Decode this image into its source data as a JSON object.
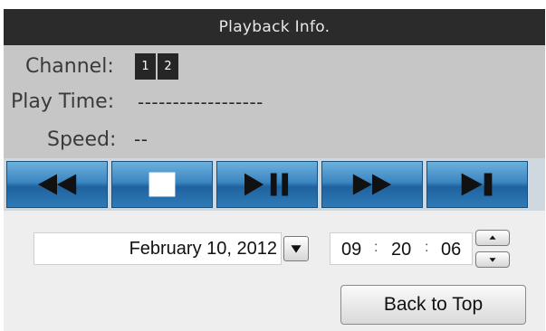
{
  "header": {
    "title": "Playback Info."
  },
  "info": {
    "channel_label": "Channel:",
    "channels": [
      "1",
      "2"
    ],
    "play_time_label": "Play Time:",
    "play_time_value": "------------------",
    "speed_label": "Speed:",
    "speed_value": "--"
  },
  "controls": {
    "buttons": [
      {
        "icon": "rewind-icon"
      },
      {
        "icon": "stop-icon"
      },
      {
        "icon": "play-pause-icon"
      },
      {
        "icon": "fast-forward-icon"
      },
      {
        "icon": "next-frame-icon"
      }
    ],
    "accent_color": "#2e7bb8"
  },
  "date": {
    "value": "February 10, 2012",
    "dropdown_icon": "chevron-down-icon"
  },
  "time": {
    "hour": "09",
    "minute": "20",
    "second": "06",
    "separator": ":"
  },
  "back_to_top_label": "Back to Top"
}
